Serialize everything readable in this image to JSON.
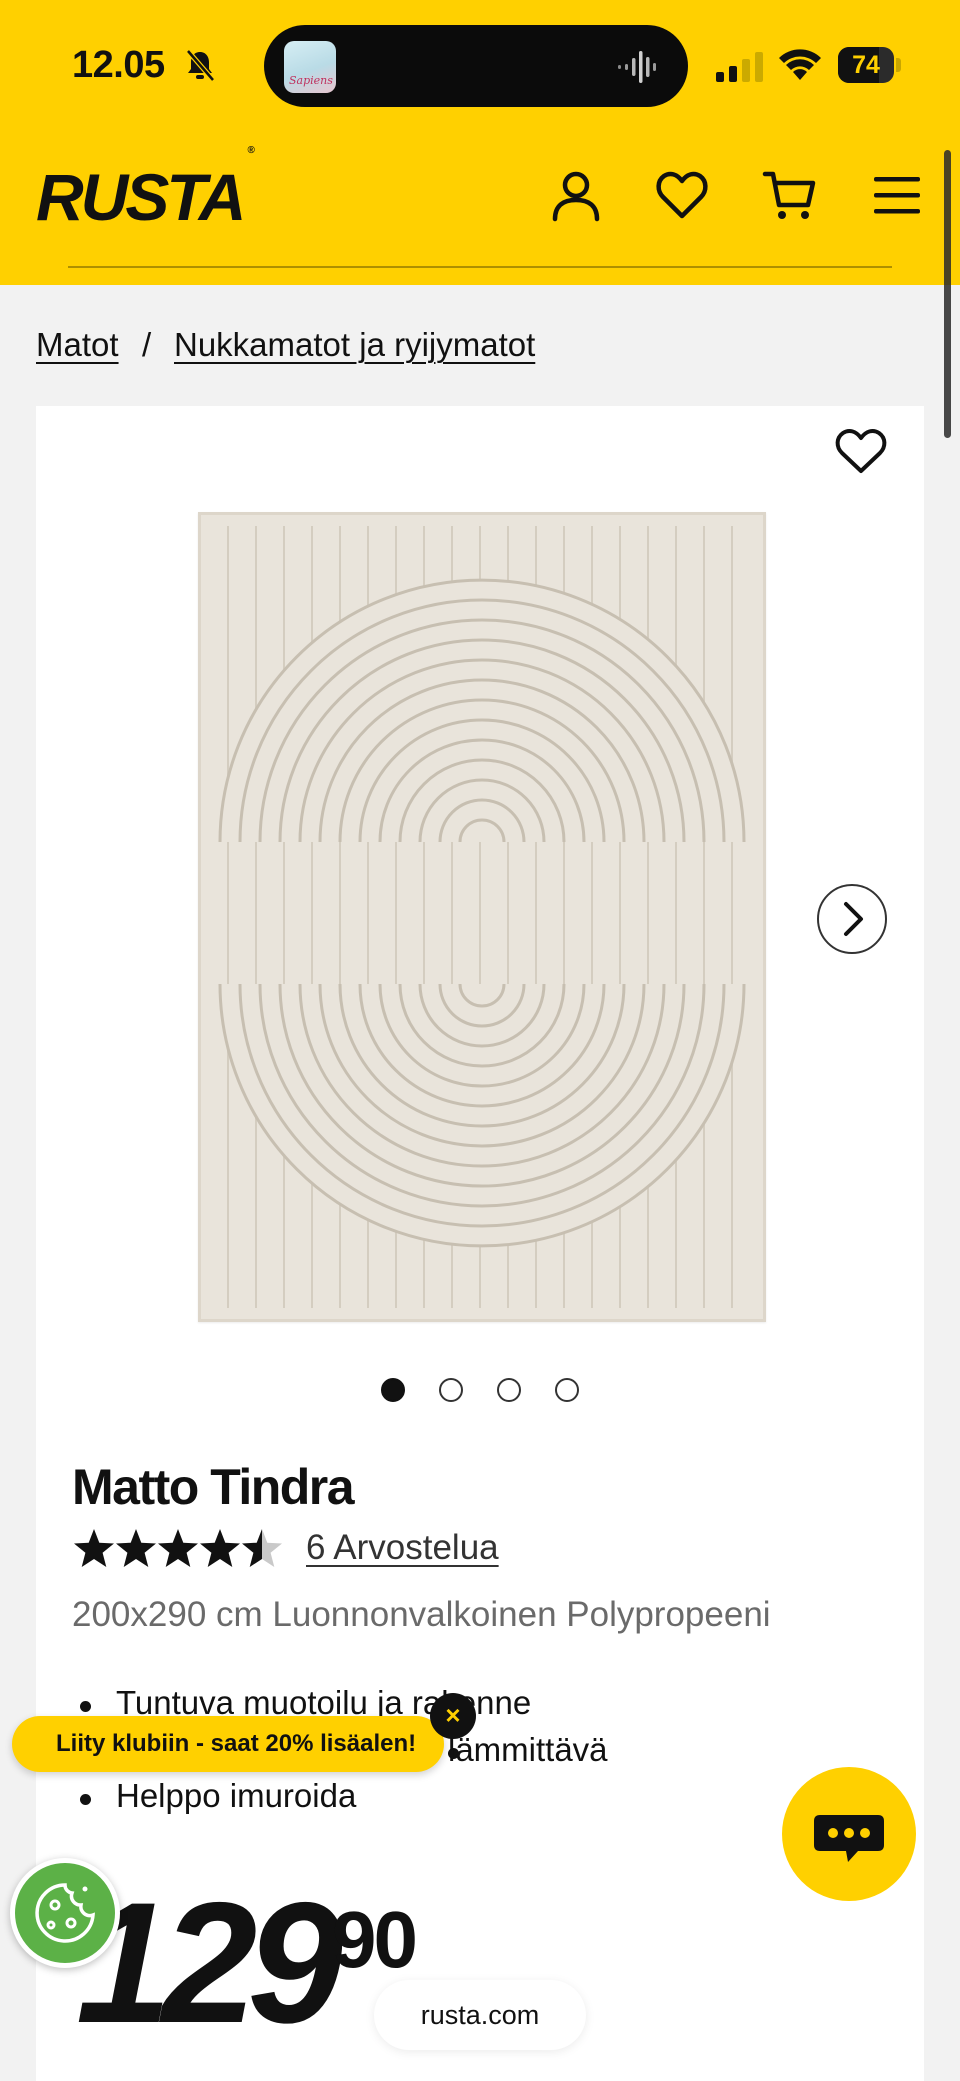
{
  "status_bar": {
    "time": "12.05",
    "battery": 74
  },
  "now_playing": {
    "artwork_text": "Sapiens"
  },
  "header": {
    "logo": "RUSTA",
    "logo_mark": "®",
    "icons": [
      "user-icon",
      "heart-icon",
      "cart-icon",
      "menu-icon"
    ],
    "accent_color": "#ffd000"
  },
  "breadcrumb": {
    "items": [
      "Matot",
      "Nukkamatot ja ryijymatot"
    ],
    "separator": "/"
  },
  "gallery": {
    "image_count": 4,
    "active_index": 0
  },
  "product": {
    "title": "Matto Tindra",
    "rating": 4.5,
    "reviews_label": "6 Arvostelua",
    "variant": "200x290 cm Luonnonvalkoinen Polypropeeni",
    "features": [
      "Tuntuva muotoilu ja rakenne",
      "lämmittävä",
      "Helppo imuroida"
    ],
    "price_whole": "129",
    "price_decimals": "90"
  },
  "promo": {
    "text": "Liity klubiin - saat 20% lisäalen!",
    "close": "×"
  },
  "browser": {
    "url": "rusta.com"
  }
}
